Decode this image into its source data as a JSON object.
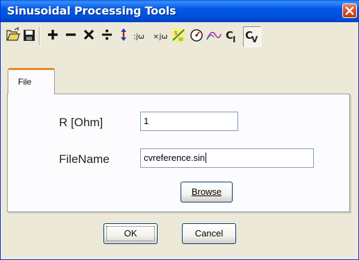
{
  "window": {
    "title": "Sinusoidal Processing Tools"
  },
  "toolbar": {
    "items": [
      {
        "name": "open-folder-icon"
      },
      {
        "name": "save-disk-icon"
      },
      {
        "name": "add-icon",
        "symbol": "+"
      },
      {
        "name": "subtract-icon",
        "symbol": "−"
      },
      {
        "name": "multiply-icon",
        "symbol": "×"
      },
      {
        "name": "divide-icon",
        "symbol": "÷"
      },
      {
        "name": "up-down-arrow-icon"
      },
      {
        "name": "divide-jw-icon",
        "text": ":jω"
      },
      {
        "name": "multiply-jw-icon",
        "text": "×jω"
      },
      {
        "name": "power-icon"
      },
      {
        "name": "gauge-icon"
      },
      {
        "name": "curve-icon"
      },
      {
        "name": "ci-icon",
        "text": "C",
        "sub": "I"
      },
      {
        "name": "cv-icon",
        "text": "C",
        "sub": "V"
      }
    ]
  },
  "tabs": [
    {
      "label": "File",
      "selected": true
    }
  ],
  "form": {
    "r_label": "R [Ohm]",
    "r_value": "1",
    "filename_label": "FileName",
    "filename_value": "cvreference.sin",
    "browse_label": "Browse"
  },
  "buttons": {
    "ok": "OK",
    "cancel": "Cancel"
  },
  "colors": {
    "titlebar": "#0058e6",
    "tab_highlight": "#e68b2c",
    "close": "#d3471e"
  }
}
